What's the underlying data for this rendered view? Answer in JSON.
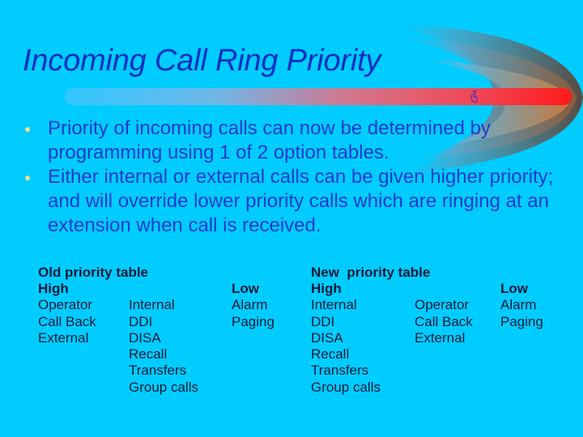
{
  "slide": {
    "title": "Incoming Call Ring Priority",
    "decoration_icon": "hand-fingers-crossed-icon",
    "colors": {
      "background": "#00ccff",
      "title": "#0a2fc4",
      "body_text": "#1e3ad0",
      "bullet": "#f2e08a",
      "table_text": "#0b1a3a",
      "bar_end": "#ff1a1a"
    },
    "bullets": [
      "Priority of incoming calls can now be determined by programming using 1 of 2 option tables.",
      "Either internal or external calls can be given higher priority; and will override lower priority calls which are ringing at an extension when call is received."
    ],
    "old_table": {
      "title": "Old priority table",
      "high_label": "High",
      "low_label": "Low",
      "high_column": [
        "Operator",
        "Call Back",
        "External"
      ],
      "middle_column": [
        "Internal",
        "DDI",
        "DISA",
        "Recall",
        "Transfers",
        "Group calls"
      ],
      "low_column": [
        "Alarm",
        "Paging"
      ]
    },
    "new_table": {
      "title": "New  priority table",
      "high_label": "High",
      "low_label": "Low",
      "high_column": [
        "Internal",
        "DDI",
        "DISA",
        "Recall",
        "Transfers",
        "Group calls"
      ],
      "middle_column": [
        "Operator",
        "Call Back",
        "External"
      ],
      "low_column": [
        "Alarm",
        "Paging"
      ]
    }
  }
}
